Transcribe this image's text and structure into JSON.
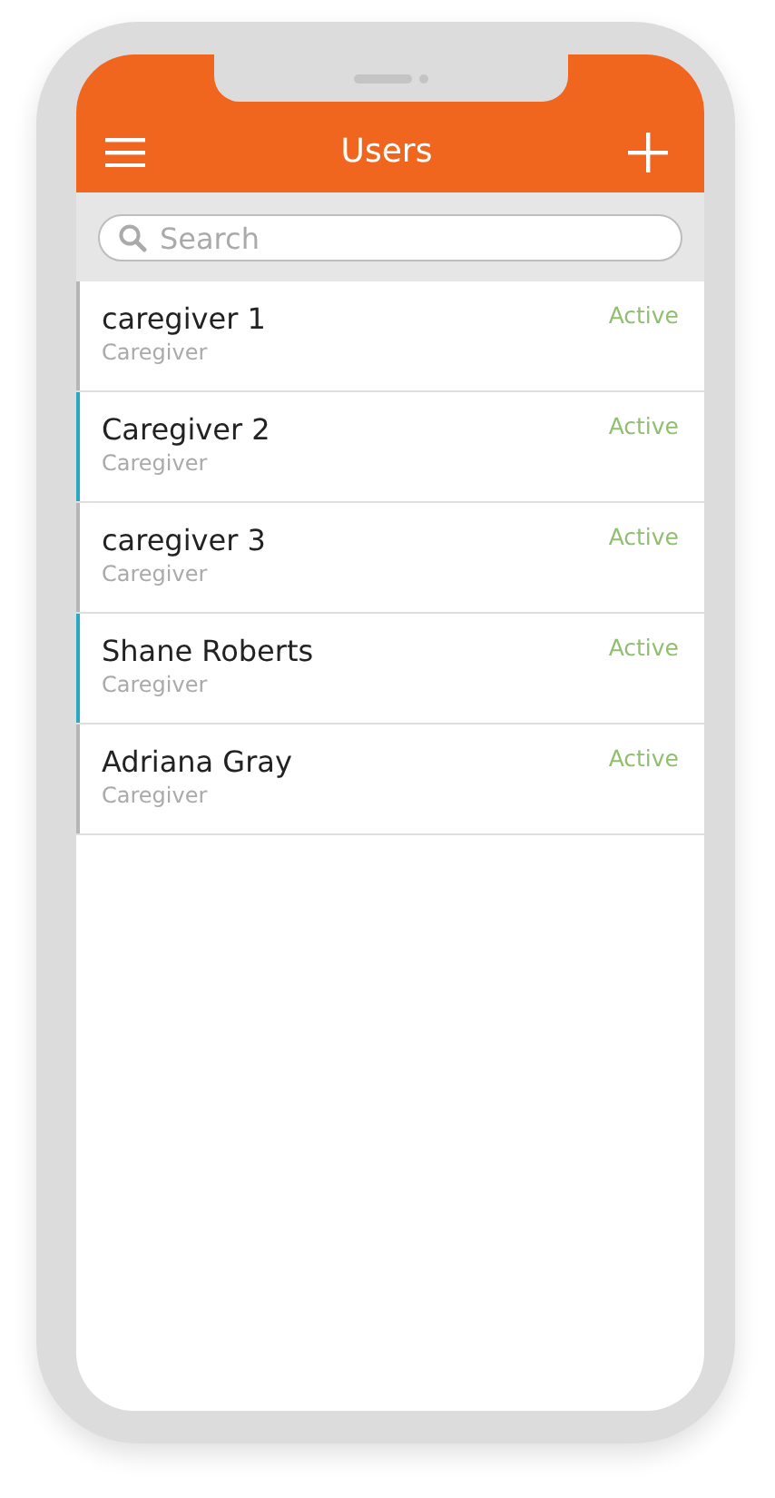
{
  "header": {
    "title": "Users"
  },
  "search": {
    "placeholder": "Search"
  },
  "users": [
    {
      "name": "caregiver 1",
      "role": "Caregiver",
      "status": "Active",
      "color": "#b5b5b5"
    },
    {
      "name": "Caregiver 2",
      "role": "Caregiver",
      "status": "Active",
      "color": "#29a8c4"
    },
    {
      "name": "caregiver 3",
      "role": "Caregiver",
      "status": "Active",
      "color": "#b5b5b5"
    },
    {
      "name": "Shane Roberts",
      "role": "Caregiver",
      "status": "Active",
      "color": "#29a8c4"
    },
    {
      "name": "Adriana Gray",
      "role": "Caregiver",
      "status": "Active",
      "color": "#b5b5b5"
    }
  ]
}
